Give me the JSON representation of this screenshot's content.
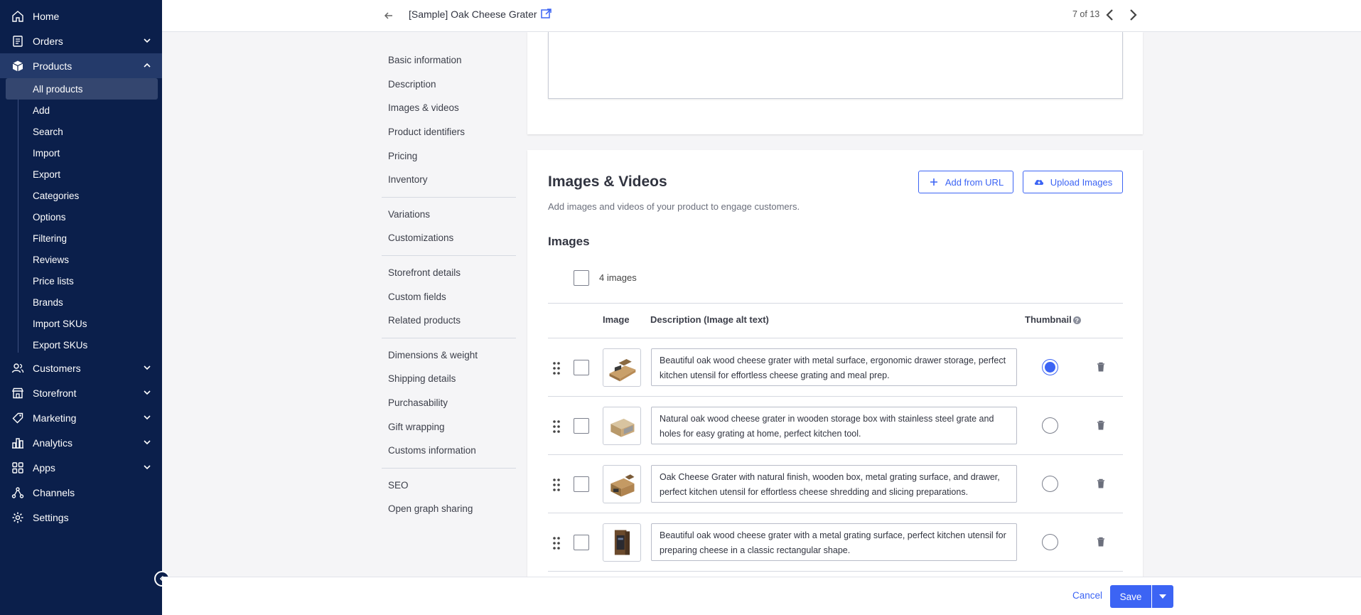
{
  "sidebar": {
    "items_top": [
      {
        "label": "Home",
        "icon": "home-icon"
      },
      {
        "label": "Orders",
        "icon": "orders-icon",
        "chevron": "down"
      },
      {
        "label": "Products",
        "icon": "products-icon",
        "chevron": "up"
      }
    ],
    "products_sub": [
      "All products",
      "Add",
      "Search",
      "Import",
      "Export",
      "Categories",
      "Options",
      "Filtering",
      "Reviews",
      "Price lists",
      "Brands",
      "Import SKUs",
      "Export SKUs"
    ],
    "items_bottom": [
      {
        "label": "Customers",
        "icon": "customers-icon",
        "chevron": "down"
      },
      {
        "label": "Storefront",
        "icon": "storefront-icon",
        "chevron": "down"
      },
      {
        "label": "Marketing",
        "icon": "marketing-icon",
        "chevron": "down"
      },
      {
        "label": "Analytics",
        "icon": "analytics-icon",
        "chevron": "down"
      },
      {
        "label": "Apps",
        "icon": "apps-icon",
        "chevron": "down"
      },
      {
        "label": "Channels",
        "icon": "channels-icon"
      },
      {
        "label": "Settings",
        "icon": "settings-icon"
      }
    ]
  },
  "header": {
    "title": "[Sample] Oak Cheese Grater",
    "pager": "7 of 13"
  },
  "section_nav": {
    "groups": [
      [
        "Basic information",
        "Description",
        "Images & videos",
        "Product identifiers",
        "Pricing",
        "Inventory"
      ],
      [
        "Variations",
        "Customizations"
      ],
      [
        "Storefront details",
        "Custom fields",
        "Related products"
      ],
      [
        "Dimensions & weight",
        "Shipping details",
        "Purchasability",
        "Gift wrapping",
        "Customs information"
      ],
      [
        "SEO",
        "Open graph sharing"
      ]
    ]
  },
  "images_card": {
    "title": "Images & Videos",
    "subtitle": "Add images and videos of your product to engage customers.",
    "add_from_url": "Add from URL",
    "upload_images": "Upload Images",
    "images_heading": "Images",
    "count_label": "4 images",
    "columns": {
      "image": "Image",
      "description": "Description (Image alt text)",
      "thumbnail": "Thumbnail"
    },
    "help_glyph": "?",
    "rows": [
      {
        "alt": "Beautiful oak wood cheese grater with metal surface, ergonomic drawer storage, perfect kitchen utensil for effortless cheese grating and meal prep.",
        "thumbnail": true
      },
      {
        "alt": "Natural oak wood cheese grater in wooden storage box with stainless steel grate and holes for easy grating at home, perfect kitchen tool.",
        "thumbnail": false
      },
      {
        "alt": "Oak Cheese Grater with natural finish, wooden box, metal grating surface, and drawer, perfect kitchen utensil for effortless cheese shredding and slicing preparations.",
        "thumbnail": false
      },
      {
        "alt": "Beautiful oak wood cheese grater with a metal grating surface, perfect kitchen utensil for preparing cheese in a classic rectangular shape.",
        "thumbnail": false
      }
    ]
  },
  "footer": {
    "cancel": "Cancel",
    "save": "Save"
  },
  "colors": {
    "sidebar_bg": "#0b1f4b",
    "accent": "#3c64f4"
  }
}
